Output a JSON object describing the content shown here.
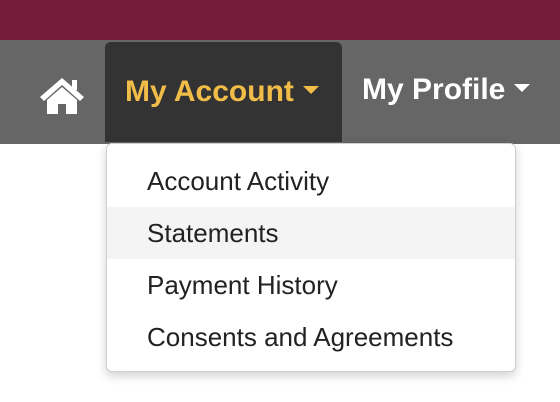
{
  "colors": {
    "top_band": "#761a39",
    "navbar": "#666666",
    "active_tab_bg": "#333333",
    "active_tab_text": "#f1bd48",
    "hover_item_bg": "#f4f4f4"
  },
  "navbar": {
    "home_icon": "home-icon",
    "items": [
      {
        "label": "My Account",
        "active": true,
        "icon": "caret-down-icon"
      },
      {
        "label": "My Profile",
        "active": false,
        "icon": "caret-down-icon"
      }
    ]
  },
  "dropdown": {
    "items": [
      {
        "label": "Account Activity"
      },
      {
        "label": "Statements",
        "highlighted": true
      },
      {
        "label": "Payment History"
      },
      {
        "label": "Consents and Agreements"
      }
    ]
  }
}
